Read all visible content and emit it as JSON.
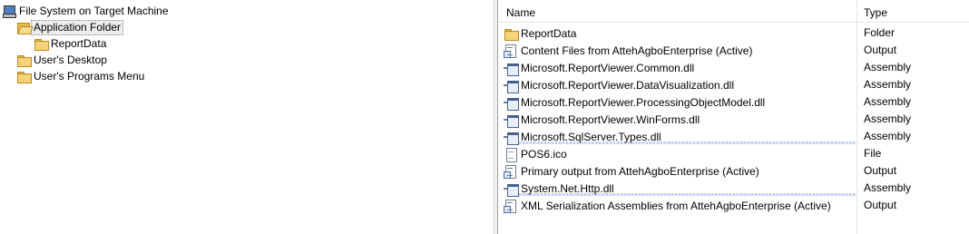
{
  "tree": {
    "root": {
      "label": "File System on Target Machine",
      "icon": "computer-icon"
    },
    "nodes": [
      {
        "label": "Application Folder",
        "icon": "folder-open-icon",
        "selected": true
      },
      {
        "label": "ReportData",
        "icon": "folder-icon"
      },
      {
        "label": "User's Desktop",
        "icon": "folder-icon"
      },
      {
        "label": "User's Programs Menu",
        "icon": "folder-icon"
      }
    ]
  },
  "list": {
    "columns": {
      "name": "Name",
      "type": "Type"
    },
    "rows": [
      {
        "name": "ReportData",
        "type": "Folder",
        "icon": "folder-icon"
      },
      {
        "name": "Content Files from AttehAgboEnterprise (Active)",
        "type": "Output",
        "icon": "output-icon"
      },
      {
        "name": "Microsoft.ReportViewer.Common.dll",
        "type": "Assembly",
        "icon": "dll-icon"
      },
      {
        "name": "Microsoft.ReportViewer.DataVisualization.dll",
        "type": "Assembly",
        "icon": "dll-icon"
      },
      {
        "name": "Microsoft.ReportViewer.ProcessingObjectModel.dll",
        "type": "Assembly",
        "icon": "dll-icon"
      },
      {
        "name": "Microsoft.ReportViewer.WinForms.dll",
        "type": "Assembly",
        "icon": "dll-icon"
      },
      {
        "name": "Microsoft.SqlServer.Types.dll",
        "type": "Assembly",
        "icon": "dll-icon",
        "warning": true
      },
      {
        "name": "POS6.ico",
        "type": "File",
        "icon": "file-icon"
      },
      {
        "name": "Primary output from AttehAgboEnterprise (Active)",
        "type": "Output",
        "icon": "output-icon"
      },
      {
        "name": "System.Net.Http.dll",
        "type": "Assembly",
        "icon": "dll-icon",
        "warning": true
      },
      {
        "name": "XML Serialization Assemblies from AttehAgboEnterprise (Active)",
        "type": "Output",
        "icon": "output-icon"
      }
    ]
  }
}
